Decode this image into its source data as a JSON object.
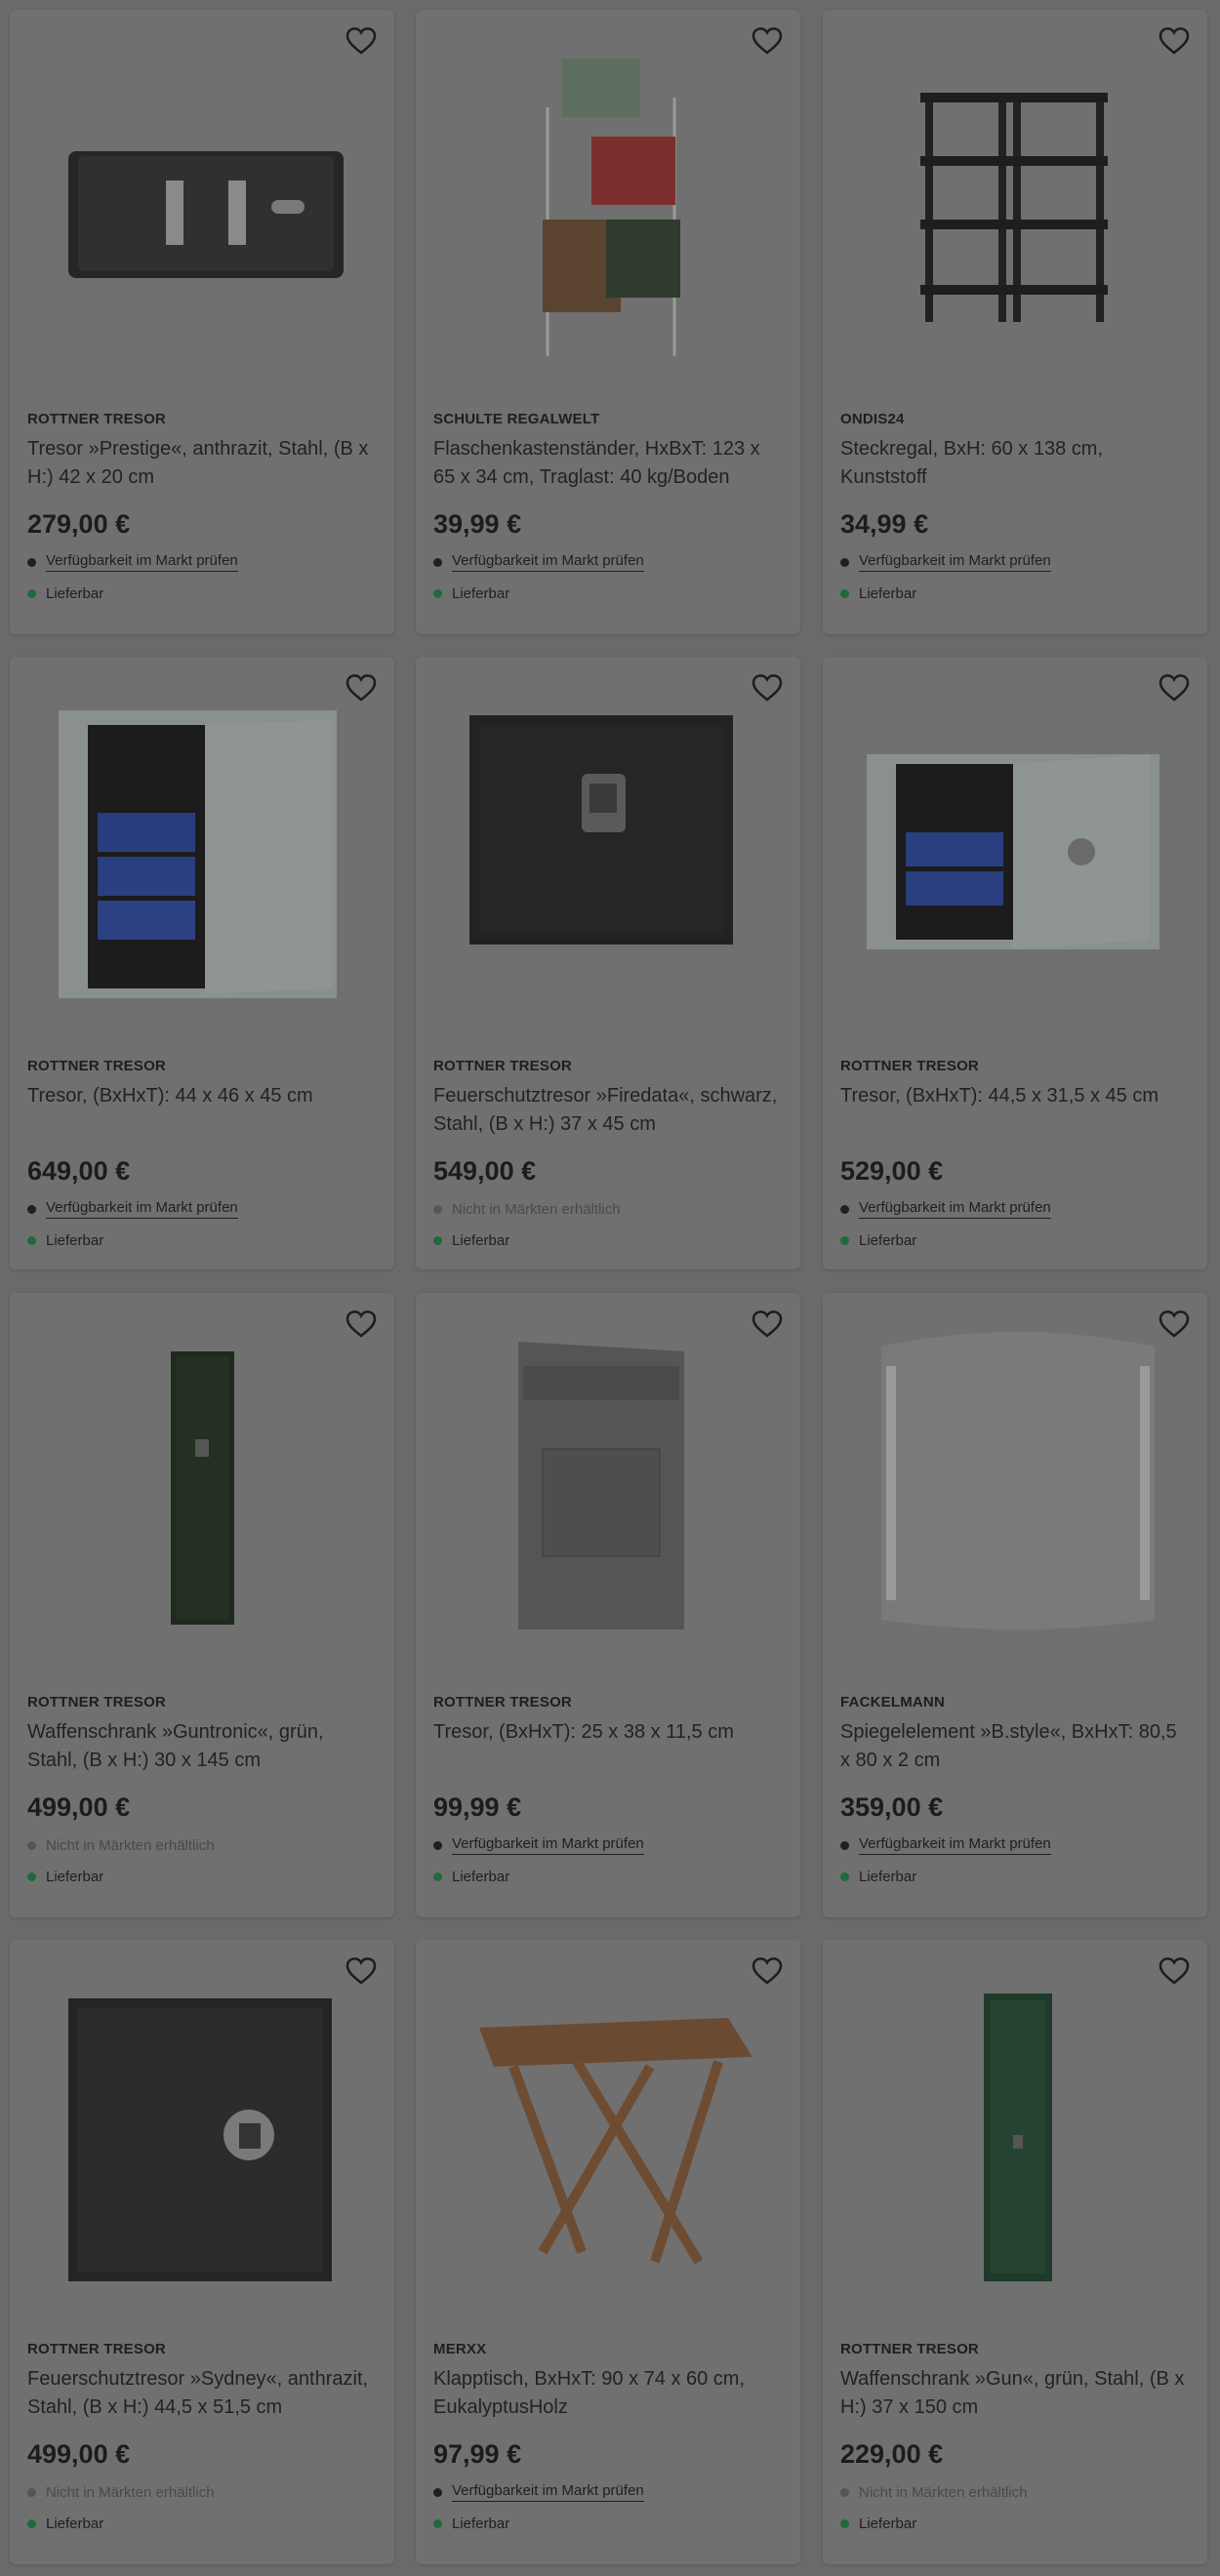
{
  "products": [
    {
      "brand": "ROTTNER TRESOR",
      "title": "Tresor »Prestige«, anthrazit, Stahl, (B x H:) 42 x 20 cm",
      "price": "279,00 €",
      "availability": "Verfügbarkeit im Markt prüfen",
      "availability_type": "link",
      "delivery": "Lieferbar",
      "image": "safe-prestige"
    },
    {
      "brand": "SCHULTE REGALWELT",
      "title": "Flaschenkastenständer, HxBxT: 123 x 65 x 34 cm, Traglast: 40 kg/Boden",
      "price": "39,99 €",
      "availability": "Verfügbarkeit im Markt prüfen",
      "availability_type": "link",
      "delivery": "Lieferbar",
      "image": "crate-stand"
    },
    {
      "brand": "ONDIS24",
      "title": "Steckregal, BxH: 60 x 138 cm, Kunststoff",
      "price": "34,99 €",
      "availability": "Verfügbarkeit im Markt prüfen",
      "availability_type": "link",
      "delivery": "Lieferbar",
      "image": "shelf"
    },
    {
      "brand": "ROTTNER TRESOR",
      "title": "Tresor, (BxHxT): 44 x 46 x 45 cm",
      "price": "649,00 €",
      "availability": "Verfügbarkeit im Markt prüfen",
      "availability_type": "link",
      "delivery": "Lieferbar",
      "image": "safe-open-white"
    },
    {
      "brand": "ROTTNER TRESOR",
      "title": "Feuerschutztresor »Firedata«, schwarz, Stahl, (B x H:) 37 x 45 cm",
      "price": "549,00 €",
      "availability": "Nicht in Märkten erhältlich",
      "availability_type": "muted",
      "delivery": "Lieferbar",
      "image": "safe-firedata"
    },
    {
      "brand": "ROTTNER TRESOR",
      "title": "Tresor, (BxHxT): 44,5 x 31,5 x 45 cm",
      "price": "529,00 €",
      "availability": "Verfügbarkeit im Markt prüfen",
      "availability_type": "link",
      "delivery": "Lieferbar",
      "image": "safe-open-small"
    },
    {
      "brand": "ROTTNER TRESOR",
      "title": "Waffenschrank »Guntronic«, grün, Stahl, (B x H:) 30 x 145 cm",
      "price": "499,00 €",
      "availability": "Nicht in Märkten erhältlich",
      "availability_type": "muted",
      "delivery": "Lieferbar",
      "image": "gun-cabinet"
    },
    {
      "brand": "ROTTNER TRESOR",
      "title": "Tresor, (BxHxT): 25 x 38 x 11,5 cm",
      "price": "99,99 €",
      "availability": "Verfügbarkeit im Markt prüfen",
      "availability_type": "link",
      "delivery": "Lieferbar",
      "image": "deposit-box"
    },
    {
      "brand": "FACKELMANN",
      "title": "Spiegelelement »B.style«, BxHxT: 80,5 x 80 x 2 cm",
      "price": "359,00 €",
      "availability": "Verfügbarkeit im Markt prüfen",
      "availability_type": "link",
      "delivery": "Lieferbar",
      "image": "mirror"
    },
    {
      "brand": "ROTTNER TRESOR",
      "title": "Feuerschutztresor »Sydney«, anthrazit, Stahl, (B x H:) 44,5 x 51,5 cm",
      "price": "499,00 €",
      "availability": "Nicht in Märkten erhältlich",
      "availability_type": "muted",
      "delivery": "Lieferbar",
      "image": "safe-sydney"
    },
    {
      "brand": "MERXX",
      "title": "Klapptisch, BxHxT: 90 x 74 x 60 cm, EukalyptusHolz",
      "price": "97,99 €",
      "availability": "Verfügbarkeit im Markt prüfen",
      "availability_type": "link",
      "delivery": "Lieferbar",
      "image": "folding-table"
    },
    {
      "brand": "ROTTNER TRESOR",
      "title": "Waffenschrank »Gun«, grün, Stahl, (B x H:) 37 x 150 cm",
      "price": "229,00 €",
      "availability": "Nicht in Märkten erhältlich",
      "availability_type": "muted",
      "delivery": "Lieferbar",
      "image": "gun-cabinet-slim"
    }
  ],
  "colors": {
    "overlay_bg": "#6a6a6a",
    "card_bg": "#707070",
    "delivery_dot": "#1f6a3d"
  },
  "icons": {
    "favorite": "heart-outline-icon",
    "availability": "dot-icon",
    "delivery": "green-dot-icon"
  }
}
